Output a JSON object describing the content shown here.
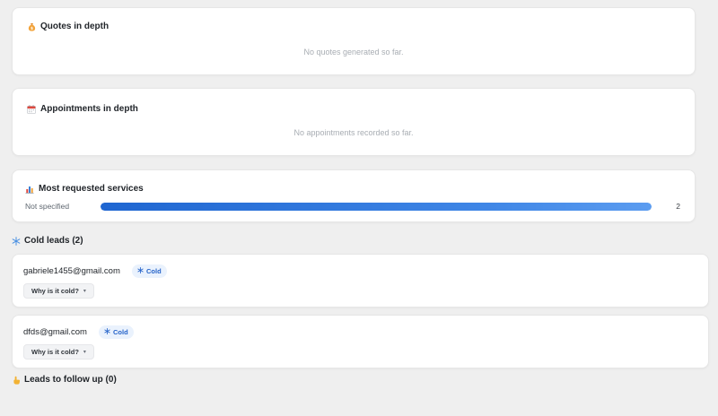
{
  "quotes": {
    "icon": "money-bag-icon",
    "title": "Quotes in depth",
    "empty": "No quotes generated so far."
  },
  "appointments": {
    "icon": "calendar-icon",
    "title": "Appointments in depth",
    "empty": "No appointments recorded so far."
  },
  "services": {
    "icon": "bar-chart-icon",
    "title": "Most requested services",
    "items": [
      {
        "label": "Not specified",
        "count": "2",
        "share": 1.0
      }
    ]
  },
  "cold_leads": {
    "icon": "snowflake-icon",
    "title": "Cold leads (2)",
    "items": [
      {
        "email": "gabriele1455@gmail.com",
        "badge": "Cold",
        "why_label": "Why is it cold?"
      },
      {
        "email": "dfds@gmail.com",
        "badge": "Cold",
        "why_label": "Why is it cold?"
      }
    ]
  },
  "follow_up": {
    "icon": "hand-icon",
    "title": "Leads to follow up (0)"
  },
  "colors": {
    "page_bg": "#efefef",
    "card_bg": "#ffffff",
    "bar_fill": "#1f66d1",
    "badge_bg": "#eaf2fd",
    "badge_text": "#2563c9"
  }
}
